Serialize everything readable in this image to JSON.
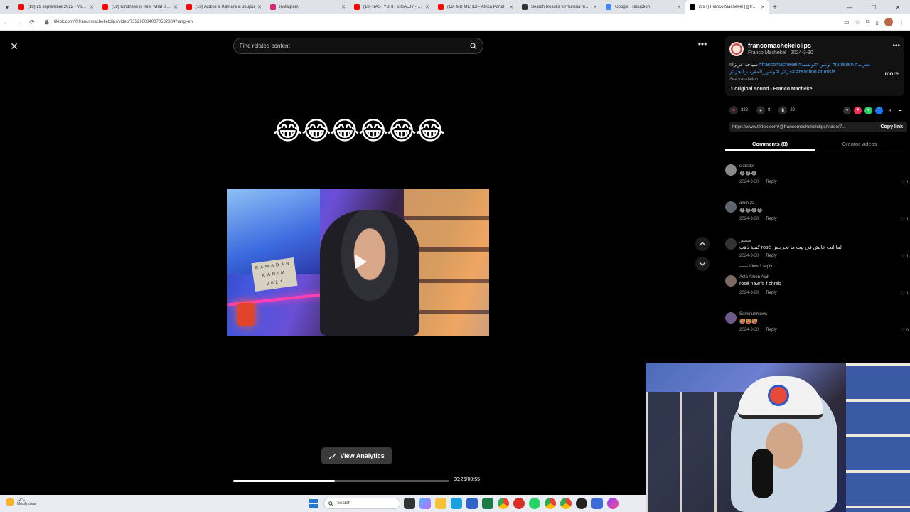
{
  "browser": {
    "tabs": [
      {
        "label": "(18) 29 septembre 2022 - YouTube",
        "color": "#ff0000"
      },
      {
        "label": "(18) Kindness is free, what is on",
        "color": "#ff0000"
      },
      {
        "label": "(18) Azizos & Kamara & Joujou",
        "color": "#ff0000"
      },
      {
        "label": "Instagram",
        "color": "#d62976"
      },
      {
        "label": "(18) NASTYSHIT x GALJY - No",
        "color": "#ff0000"
      },
      {
        "label": "(18) MD MEHDI - Africa Portal",
        "color": "#ff0000"
      },
      {
        "label": "Search Results for 'tunisia musi'",
        "color": "#333333"
      },
      {
        "label": "Google Traduction",
        "color": "#4285f4"
      },
      {
        "label": "(99+) Franco Machekel (@franco",
        "color": "#000000"
      }
    ],
    "active_tab_index": 8,
    "url": "tiktok.com/@francomachekelclips/video/7352100840070532384?lang=en"
  },
  "player": {
    "search_placeholder": "Find related content",
    "emoji_caption": "😂😂😂😂😂😂",
    "sign_text": "RAMADAN KARIM 2024",
    "analytics_label": "View Analytics",
    "time": "00:26/00:55",
    "progress": 0.47
  },
  "panel": {
    "username": "francomachekelclips",
    "subline": "Franco  Machekel · 2024-3-30",
    "caption_prefix": "!!سياحة عزيزا ",
    "caption_tags": "#francomachekel #تونس #تونسية #tunisiam #مغرب #جزائر #تونس_المغرب_الجزائر #reaction #tunisia ...",
    "more_label": "more",
    "translation_label": "See translation",
    "sound": "original sound - Franco  Machekel",
    "likes": "322",
    "comments_count": "8",
    "saves": "22",
    "link": "https://www.tiktok.com/@francomachekelclips/video/7...",
    "copy_link": "Copy link",
    "tab_comments": "Comments (8)",
    "tab_creator": "Creator videos"
  },
  "comments": [
    {
      "user": "skander",
      "text": "😂😂😂",
      "date": "2024-3-30",
      "reply": "Reply",
      "likes": "1",
      "avatar": "#8a8a8a"
    },
    {
      "user": "amin 23",
      "text": "😂😂😂😂",
      "date": "2024-3-30",
      "reply": "Reply",
      "likes": "1",
      "avatar": "#5d6470"
    },
    {
      "user": "منصور",
      "text": "كمية ذهب rosé لما انت عايش في بيت ما تخرجش",
      "date": "2024-3-30",
      "reply": "Reply",
      "likes": "1",
      "avatar": "#333333",
      "view_replies": "View 1 reply"
    },
    {
      "user": "Asta Amen Alah",
      "text": "rosé na3rfo f chrab",
      "date": "2024-3-30",
      "reply": "Reply",
      "likes": "1",
      "avatar": "#7a6a62"
    },
    {
      "user": "Samirlunmcws",
      "text": "🥵🥵🥵",
      "date": "2024-3-30",
      "reply": "Reply",
      "likes": "0",
      "avatar": "#6b5a8a"
    }
  ],
  "taskbar": {
    "temp": "12°C",
    "weather": "Mostly clear",
    "search": "Search"
  }
}
